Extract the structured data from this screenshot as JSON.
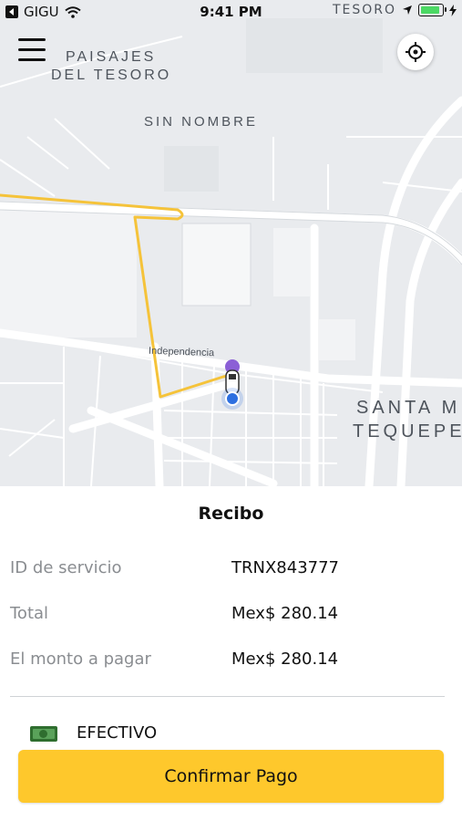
{
  "status_bar": {
    "carrier": "GIGU",
    "time": "9:41 PM",
    "map_overlap_text": "TESORO"
  },
  "map": {
    "labels": {
      "neighborhood_1_line1": "PAISAJES",
      "neighborhood_1_line2": "DEL TESORO",
      "neighborhood_2": "SIN NOMBRE",
      "neighborhood_3_line1": "SANTA M",
      "neighborhood_3_line2": "TEQUEPE",
      "street": "Independencia"
    },
    "route_color": "#f5c33a"
  },
  "receipt": {
    "title": "Recibo",
    "rows": [
      {
        "label": "ID de servicio",
        "value": "TRNX843777"
      },
      {
        "label": "Total",
        "value": "Mex$ 280.14"
      },
      {
        "label": "El monto a pagar",
        "value": "Mex$ 280.14"
      }
    ],
    "payment_method": "EFECTIVO",
    "confirm_label": "Confirmar Pago"
  },
  "colors": {
    "accent": "#fec82c",
    "cash_icon": "#2f6e2f"
  },
  "icons": [
    "back-to-app-icon",
    "wifi-icon",
    "location-arrow-icon",
    "battery-icon",
    "charging-icon",
    "menu-icon",
    "locate-icon",
    "car-icon",
    "user-location-icon",
    "cash-icon"
  ]
}
